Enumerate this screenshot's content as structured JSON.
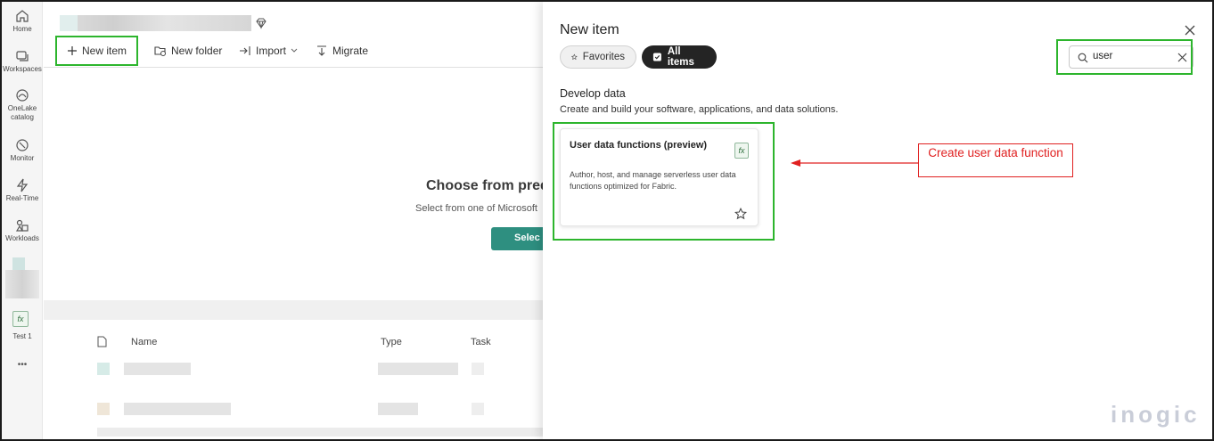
{
  "rail": {
    "items": [
      {
        "label": "Home",
        "icon": "home-icon"
      },
      {
        "label": "Workspaces",
        "icon": "workspaces-icon"
      },
      {
        "label": "OneLake catalog",
        "icon": "onelake-icon"
      },
      {
        "label": "Monitor",
        "icon": "monitor-icon"
      },
      {
        "label": "Real-Time",
        "icon": "realtime-icon"
      },
      {
        "label": "Workloads",
        "icon": "workloads-icon"
      }
    ],
    "test_item": {
      "label": "Test 1",
      "icon_text": "fx"
    },
    "more": "•••"
  },
  "toolbar": {
    "new_item": "New item",
    "new_folder": "New folder",
    "import": "Import",
    "migrate": "Migrate"
  },
  "main": {
    "choose_title": "Choose from pred",
    "choose_sub": "Select from one of Microsoft",
    "select_button": "Selec",
    "table_headers": {
      "name": "Name",
      "type": "Type",
      "task": "Task"
    }
  },
  "panel": {
    "title": "New item",
    "tabs": {
      "favorites": "Favorites",
      "all_items": "All items"
    },
    "search": {
      "value": "user"
    },
    "section": {
      "title": "Develop data",
      "description": "Create and build your software, applications, and data solutions."
    },
    "card": {
      "title": "User data functions (preview)",
      "description": "Author, host, and manage serverless user data functions optimized for Fabric.",
      "icon_text": "fx"
    }
  },
  "annotation": {
    "callout": "Create user data function"
  },
  "watermark": "inogic",
  "colors": {
    "highlight": "#2db52d",
    "annotation": "#e02020",
    "select_button": "#2e8f80",
    "all_items_pill": "#242424"
  }
}
